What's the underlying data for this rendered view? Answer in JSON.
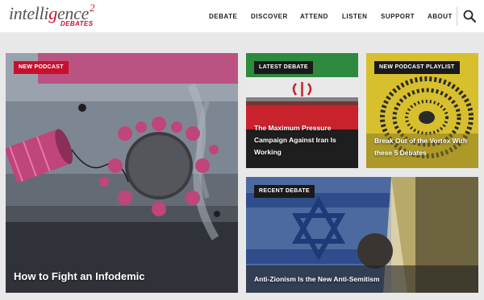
{
  "logo": {
    "word_start": "intelli",
    "word_accent": "g",
    "word_end": "ence",
    "superscript": "2",
    "subtitle": "DEBATES"
  },
  "nav": {
    "items": [
      "DEBATE",
      "DISCOVER",
      "ATTEND",
      "LISTEN",
      "SUPPORT",
      "ABOUT"
    ],
    "search_icon": "search-icon"
  },
  "tiles": {
    "infodemic": {
      "tag": "NEW PODCAST",
      "title": "How to Fight an Infodemic"
    },
    "iran": {
      "tag": "LATEST DEBATE",
      "title": "The Maximum Pressure Campaign Against Iran Is Working"
    },
    "playlist": {
      "tag": "NEW PODCAST PLAYLIST",
      "title": "Break Out of the Vortex With these 5 Debates"
    },
    "zionism": {
      "tag": "RECENT DEBATE",
      "title": "Anti-Zionism Is the New Anti-Semitism"
    }
  },
  "colors": {
    "brand_red": "#c8102e",
    "tag_dark": "#1a1a1a",
    "page_bg": "#e8e8e8"
  }
}
